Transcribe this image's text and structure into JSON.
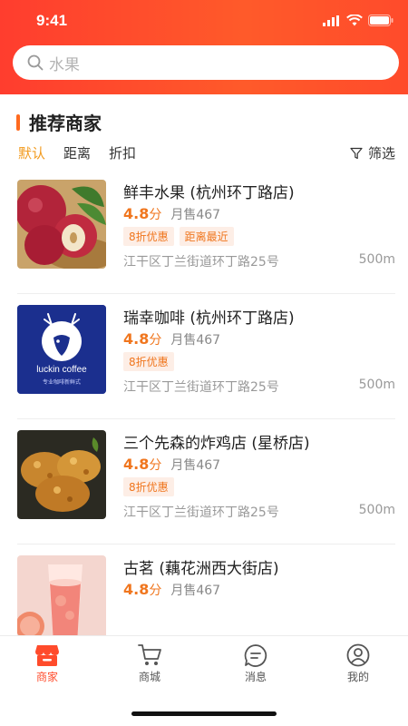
{
  "status": {
    "time": "9:41"
  },
  "search": {
    "text": "水果"
  },
  "section": {
    "title": "推荐商家"
  },
  "filters": {
    "items": [
      "默认",
      "距离",
      "折扣"
    ],
    "active_index": 0,
    "right_label": "筛选"
  },
  "shops": [
    {
      "name": "鲜丰水果 (杭州环丁路店)",
      "rating": "4.8",
      "rating_unit": "分",
      "sold": "月售467",
      "tags": [
        "8折优惠",
        "距离最近"
      ],
      "address": "江干区丁兰街道环丁路25号",
      "distance": "500m",
      "image": "apple-fruit-photo"
    },
    {
      "name": "瑞幸咖啡 (杭州环丁路店)",
      "rating": "4.8",
      "rating_unit": "分",
      "sold": "月售467",
      "tags": [
        "8折优惠"
      ],
      "address": "江干区丁兰街道环丁路25号",
      "distance": "500m",
      "image": "luckin-coffee-logo",
      "logo_text": "luckin coffee",
      "logo_sub": "专业咖啡新鲜式"
    },
    {
      "name": "三个先森的炸鸡店 (星桥店)",
      "rating": "4.8",
      "rating_unit": "分",
      "sold": "月售467",
      "tags": [
        "8折优惠"
      ],
      "address": "江干区丁兰街道环丁路25号",
      "distance": "500m",
      "image": "fried-chicken-photo"
    },
    {
      "name": "古茗 (藕花洲西大街店)",
      "rating": "4.8",
      "rating_unit": "分",
      "sold": "月售467",
      "tags": [],
      "address": "",
      "distance": "",
      "image": "grapefruit-tea-photo"
    }
  ],
  "tabbar": {
    "items": [
      {
        "label": "商家",
        "icon": "shop-icon",
        "active": true
      },
      {
        "label": "商城",
        "icon": "cart-icon",
        "active": false
      },
      {
        "label": "消息",
        "icon": "message-icon",
        "active": false
      },
      {
        "label": "我的",
        "icon": "user-icon",
        "active": false
      }
    ]
  },
  "colors": {
    "brand": "#ff4b2b",
    "accent": "#f0761e",
    "filter_active": "#f29b1f"
  }
}
